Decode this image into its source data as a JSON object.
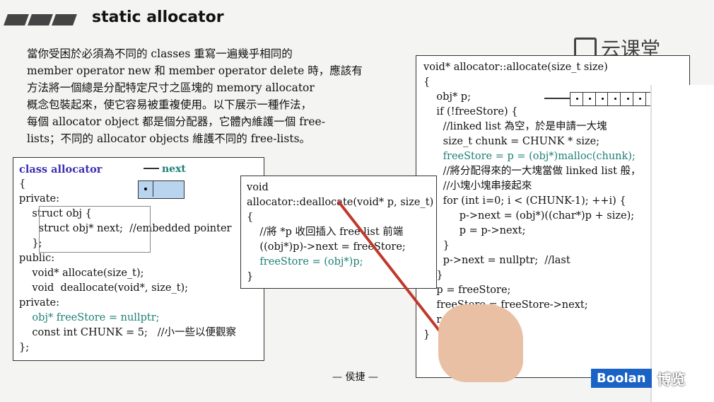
{
  "title": "static allocator",
  "watermark": "云课堂",
  "intro_lines": [
    "當你受困於必須為不同的 classes 重寫一遍幾乎相同的",
    "member operator new 和 member operator delete 時，應該有",
    "方法將一個總是分配特定尺寸之區塊的 memory allocator",
    "概念包裝起來，使它容易被重複使用。以下展示一種作法，",
    "每個 allocator object 都是個分配器，它體內維護一個 free-",
    "lists；不同的 allocator objects 維護不同的 free-lists。"
  ],
  "left_code": {
    "next_label": "next",
    "lines": [
      "class allocator",
      "{",
      "private:",
      "    struct obj {",
      "      struct obj* next;  //embedded pointer",
      "    };",
      "public:",
      "    void* allocate(size_t);",
      "    void  deallocate(void*, size_t);",
      "private:",
      "    obj* freeStore = nullptr;",
      "    const int CHUNK = 5;   //小一些以便觀察",
      "};"
    ]
  },
  "mid_code": {
    "lines": [
      "void",
      "allocator::deallocate(void* p, size_t)",
      "{",
      "    //將 *p 收回插入 free list 前端",
      "    ((obj*)p)->next = freeStore;",
      "    freeStore = (obj*)p;",
      "}"
    ]
  },
  "right_code": {
    "lines": [
      "void* allocator::allocate(size_t size)",
      "{",
      "    obj* p;",
      "",
      "    if (!freeStore) {",
      "      //linked list 為空，於是申請一大塊",
      "      size_t chunk = CHUNK * size;",
      "      freeStore = p = (obj*)malloc(chunk);",
      "",
      "      //將分配得來的一大塊當做 linked list 般，",
      "      //小塊小塊串接起來",
      "      for (int i=0; i < (CHUNK-1); ++i) {",
      "           p->next = (obj*)((char*)p + size);",
      "           p = p->next;",
      "      }",
      "      p->next = nullptr;  //last",
      "    }",
      "    p = freeStore;",
      "    freeStore = freeStore->next;",
      "    return p;",
      "}"
    ]
  },
  "author": "— 侯捷 —",
  "brand": {
    "logo": "Boolan",
    "name": "博览"
  }
}
